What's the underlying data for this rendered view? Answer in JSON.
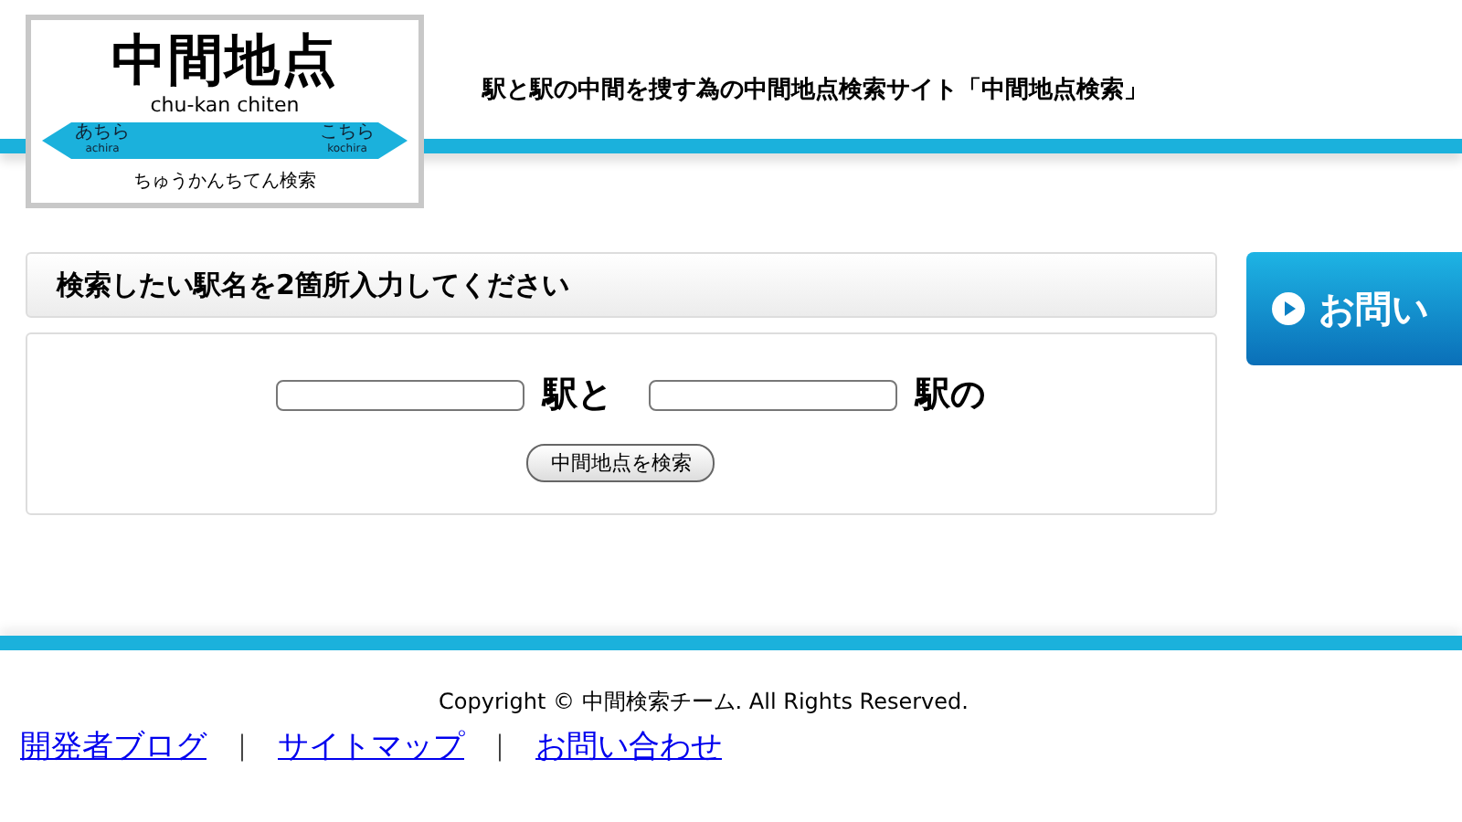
{
  "logo": {
    "title": "中間地点",
    "romaji": "chu-kan chiten",
    "left_station": "あちら",
    "left_romaji": "achira",
    "right_station": "こちら",
    "right_romaji": "kochira",
    "subtitle": "ちゅうかんちてん検索"
  },
  "tagline": "駅と駅の中間を捜す為の中間地点検索サイト「中間地点検索」",
  "search_panel": {
    "heading": "検索したい駅名を2箇所入力してください",
    "fields": [
      {
        "suffix": "駅と"
      },
      {
        "suffix": "駅の"
      }
    ],
    "button": "中間地点を検索"
  },
  "side_button": "お問い",
  "footer": {
    "copyright": "Copyright © 中間検索チーム. All Rights Reserved.",
    "links": [
      "開発者ブログ",
      "サイトマップ",
      "お問い合わせ"
    ],
    "separator": "｜"
  }
}
